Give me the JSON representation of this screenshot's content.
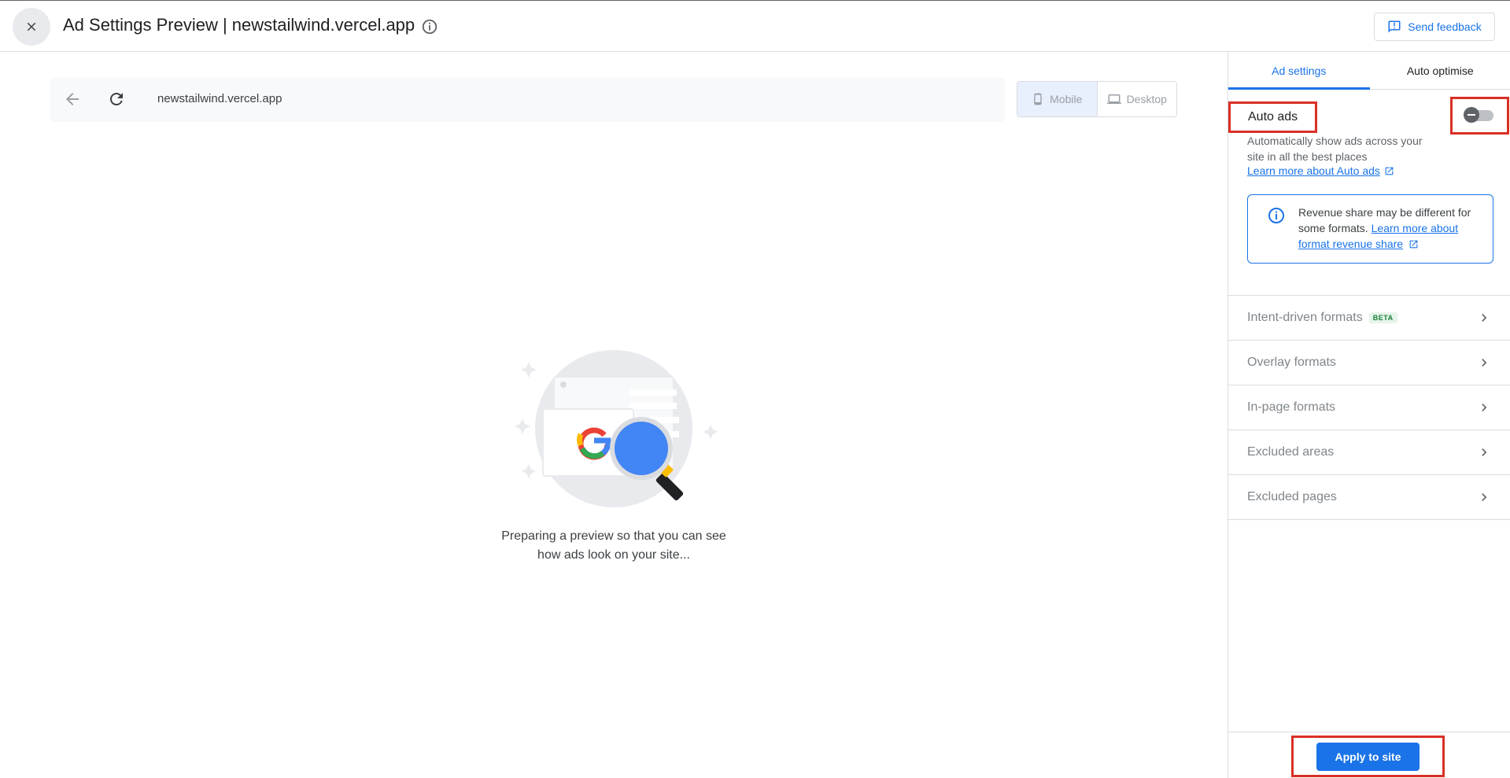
{
  "header": {
    "close_icon": "close-icon",
    "title": "Ad Settings Preview | newstailwind.vercel.app",
    "info_icon": "info-icon",
    "feedback_label": "Send feedback",
    "feedback_icon": "feedback-icon"
  },
  "preview": {
    "url": "newstailwind.vercel.app",
    "back_icon": "arrow-left-icon",
    "refresh_icon": "refresh-icon",
    "device_options": [
      {
        "label": "Mobile",
        "icon": "phone-icon",
        "selected": true
      },
      {
        "label": "Desktop",
        "icon": "laptop-icon",
        "selected": false
      }
    ],
    "loading_text_line1": "Preparing a preview so that you can see",
    "loading_text_line2": "how ads look on your site..."
  },
  "panel": {
    "tabs": [
      {
        "label": "Ad settings",
        "active": true
      },
      {
        "label": "Auto optimise",
        "active": false
      }
    ],
    "auto_ads": {
      "label": "Auto ads",
      "enabled": false,
      "description": "Automatically show ads across your site in all the best places",
      "learn_more": "Learn more about Auto ads"
    },
    "info": {
      "text": "Revenue share may be different for some formats.",
      "link": "Learn more about format revenue share"
    },
    "sections": [
      {
        "label": "Intent-driven formats",
        "badge": "BETA"
      },
      {
        "label": "Overlay formats",
        "badge": ""
      },
      {
        "label": "In-page formats",
        "badge": ""
      },
      {
        "label": "Excluded areas",
        "badge": ""
      },
      {
        "label": "Excluded pages",
        "badge": ""
      }
    ],
    "apply_label": "Apply to site"
  },
  "colors": {
    "accent": "#1a73e8",
    "highlight": "#d93025",
    "beta": "#188038"
  }
}
